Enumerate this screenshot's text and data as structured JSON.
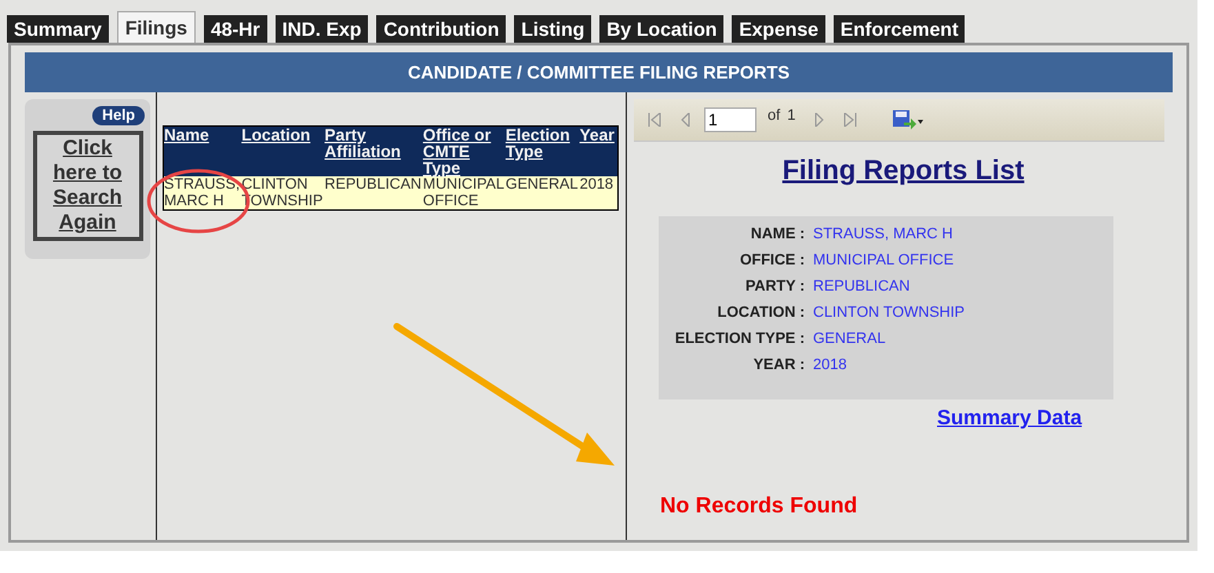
{
  "tabs": [
    {
      "label": "Summary",
      "selected": false
    },
    {
      "label": "Filings",
      "selected": true
    },
    {
      "label": "48-Hr",
      "selected": false
    },
    {
      "label": "IND. Exp",
      "selected": false
    },
    {
      "label": "Contribution",
      "selected": false
    },
    {
      "label": "Listing",
      "selected": false
    },
    {
      "label": "By Location",
      "selected": false
    },
    {
      "label": "Expense",
      "selected": false
    },
    {
      "label": "Enforcement",
      "selected": false
    }
  ],
  "header": {
    "title": "CANDIDATE / COMMITTEE FILING REPORTS"
  },
  "sidebar": {
    "help": "Help",
    "search_again": "Click here to Search Again"
  },
  "results_table": {
    "columns": [
      "Name",
      "Location",
      "Party Affiliation",
      "Office or CMTE Type",
      "Election Type",
      "Year"
    ],
    "rows": [
      [
        "STRAUSS, MARC H",
        "CLINTON TOWNSHIP",
        "REPUBLICAN",
        "MUNICIPAL OFFICE",
        "GENERAL",
        "2018"
      ]
    ]
  },
  "report": {
    "toolbar": {
      "page": "1",
      "of": "of",
      "total": "1"
    },
    "title": "Filing Reports List",
    "details": [
      {
        "label": "NAME :",
        "value": "STRAUSS, MARC H"
      },
      {
        "label": "OFFICE :",
        "value": "MUNICIPAL OFFICE"
      },
      {
        "label": "PARTY :",
        "value": "REPUBLICAN"
      },
      {
        "label": "LOCATION :",
        "value": "CLINTON TOWNSHIP"
      },
      {
        "label": "ELECTION TYPE :",
        "value": "GENERAL"
      },
      {
        "label": "YEAR :",
        "value": "2018"
      }
    ],
    "summary_link": "Summary Data",
    "message": "No Records Found"
  }
}
